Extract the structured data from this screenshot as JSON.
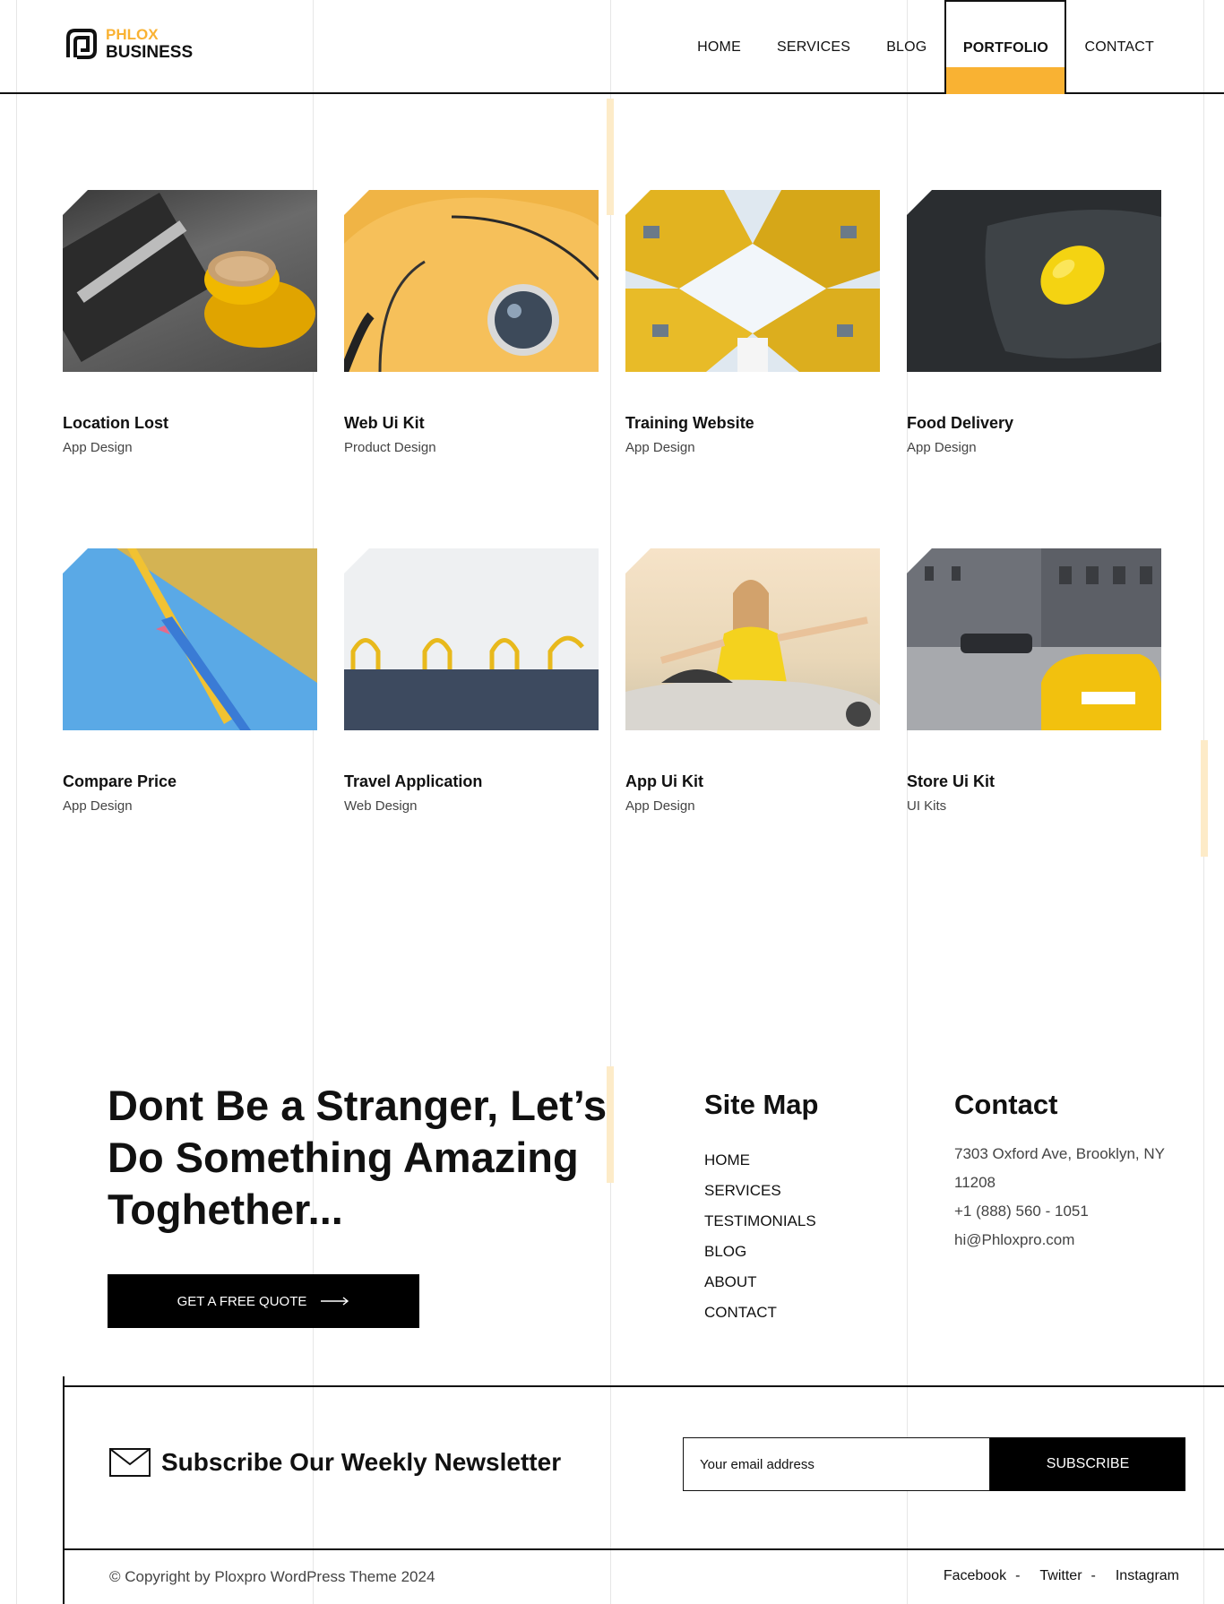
{
  "brand": {
    "top": "PHLOX",
    "bottom": "BUSINESS",
    "accent": "#f9b233"
  },
  "nav": [
    {
      "label": "HOME",
      "active": false
    },
    {
      "label": "SERVICES",
      "active": false
    },
    {
      "label": "BLOG",
      "active": false
    },
    {
      "label": "PORTFOLIO",
      "active": true
    },
    {
      "label": "CONTACT",
      "active": false
    }
  ],
  "portfolio": [
    {
      "title": "Location Lost",
      "category": "App Design",
      "image": "coffee-cup-photo"
    },
    {
      "title": "Web Ui Kit",
      "category": "Product Design",
      "image": "yellow-car-headlight-photo"
    },
    {
      "title": "Training Website",
      "category": "App Design",
      "image": "cube-houses-photo"
    },
    {
      "title": "Food Delivery",
      "category": "App Design",
      "image": "lemon-on-slate-photo"
    },
    {
      "title": "Compare Price",
      "category": "App Design",
      "image": "pencils-photo"
    },
    {
      "title": "Travel Application",
      "category": "Web Design",
      "image": "yellow-arches-photo"
    },
    {
      "title": "App Ui Kit",
      "category": "App Design",
      "image": "woman-in-convertible-photo"
    },
    {
      "title": "Store Ui Kit",
      "category": "UI Kits",
      "image": "yellow-taxi-street-photo"
    }
  ],
  "cta": {
    "title": "Dont Be a Stranger, Let’s Do Something Amazing Toghether...",
    "button": "GET A FREE QUOTE"
  },
  "sitemap": {
    "title": "Site Map",
    "links": [
      "HOME",
      "SERVICES",
      "TESTIMONIALS",
      "BLOG",
      "ABOUT",
      "CONTACT"
    ]
  },
  "contact": {
    "title": "Contact",
    "address": "7303 Oxford Ave, Brooklyn, NY 11208",
    "phone": "+1 (888) 560 - 1051",
    "email": "hi@Phloxpro.com"
  },
  "newsletter": {
    "title": "Subscribe Our Weekly Newsletter",
    "placeholder": "Your email address",
    "button": "SUBSCRIBE"
  },
  "footer": {
    "copyright": "© Copyright by Ploxpro WordPress Theme 2024",
    "social": [
      "Facebook",
      "Twitter",
      "Instagram"
    ]
  }
}
